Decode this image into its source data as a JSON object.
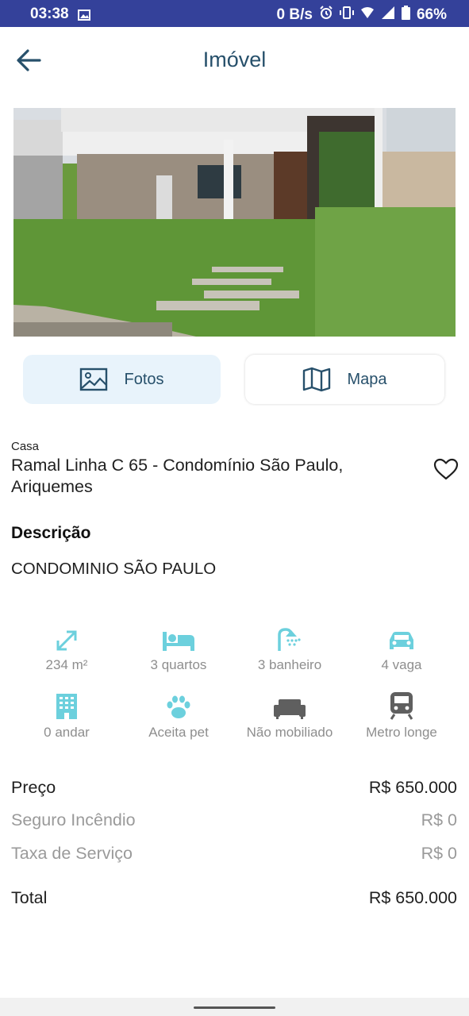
{
  "status": {
    "time": "03:38",
    "net_speed": "0 B/s",
    "battery": "66%",
    "icons": [
      "image-icon",
      "alarm-icon",
      "vibrate-icon",
      "wifi-icon",
      "signal-icon",
      "battery-icon"
    ]
  },
  "header": {
    "title": "Imóvel",
    "back_icon": "back-arrow-icon"
  },
  "tabs": {
    "photos_label": "Fotos",
    "map_label": "Mapa"
  },
  "property": {
    "type": "Casa",
    "address": "Ramal Linha C 65 - Condomínio São Paulo, Ariquemes"
  },
  "description": {
    "title": "Descrição",
    "text": "CONDOMINIO SÃO PAULO"
  },
  "features": [
    {
      "icon": "area-expand-icon",
      "label": "234 m²"
    },
    {
      "icon": "bed-icon",
      "label": "3 quartos"
    },
    {
      "icon": "shower-icon",
      "label": "3 banheiro"
    },
    {
      "icon": "car-icon",
      "label": "4 vaga"
    },
    {
      "icon": "building-icon",
      "label": "0 andar"
    },
    {
      "icon": "paw-icon",
      "label": "Aceita pet"
    },
    {
      "icon": "sofa-icon",
      "label": "Não mobiliado"
    },
    {
      "icon": "train-icon",
      "label": "Metro longe"
    }
  ],
  "prices": {
    "price_label": "Preço",
    "price_value": "R$ 650.000",
    "insurance_label": "Seguro Incêndio",
    "insurance_value": "R$ 0",
    "service_label": "Taxa de Serviço",
    "service_value": "R$ 0",
    "total_label": "Total",
    "total_value": "R$ 650.000"
  },
  "colors": {
    "status_bar": "#34419a",
    "accent": "#27506b",
    "feature_active": "#6cd0dd",
    "feature_inactive": "#5f5f5f"
  }
}
